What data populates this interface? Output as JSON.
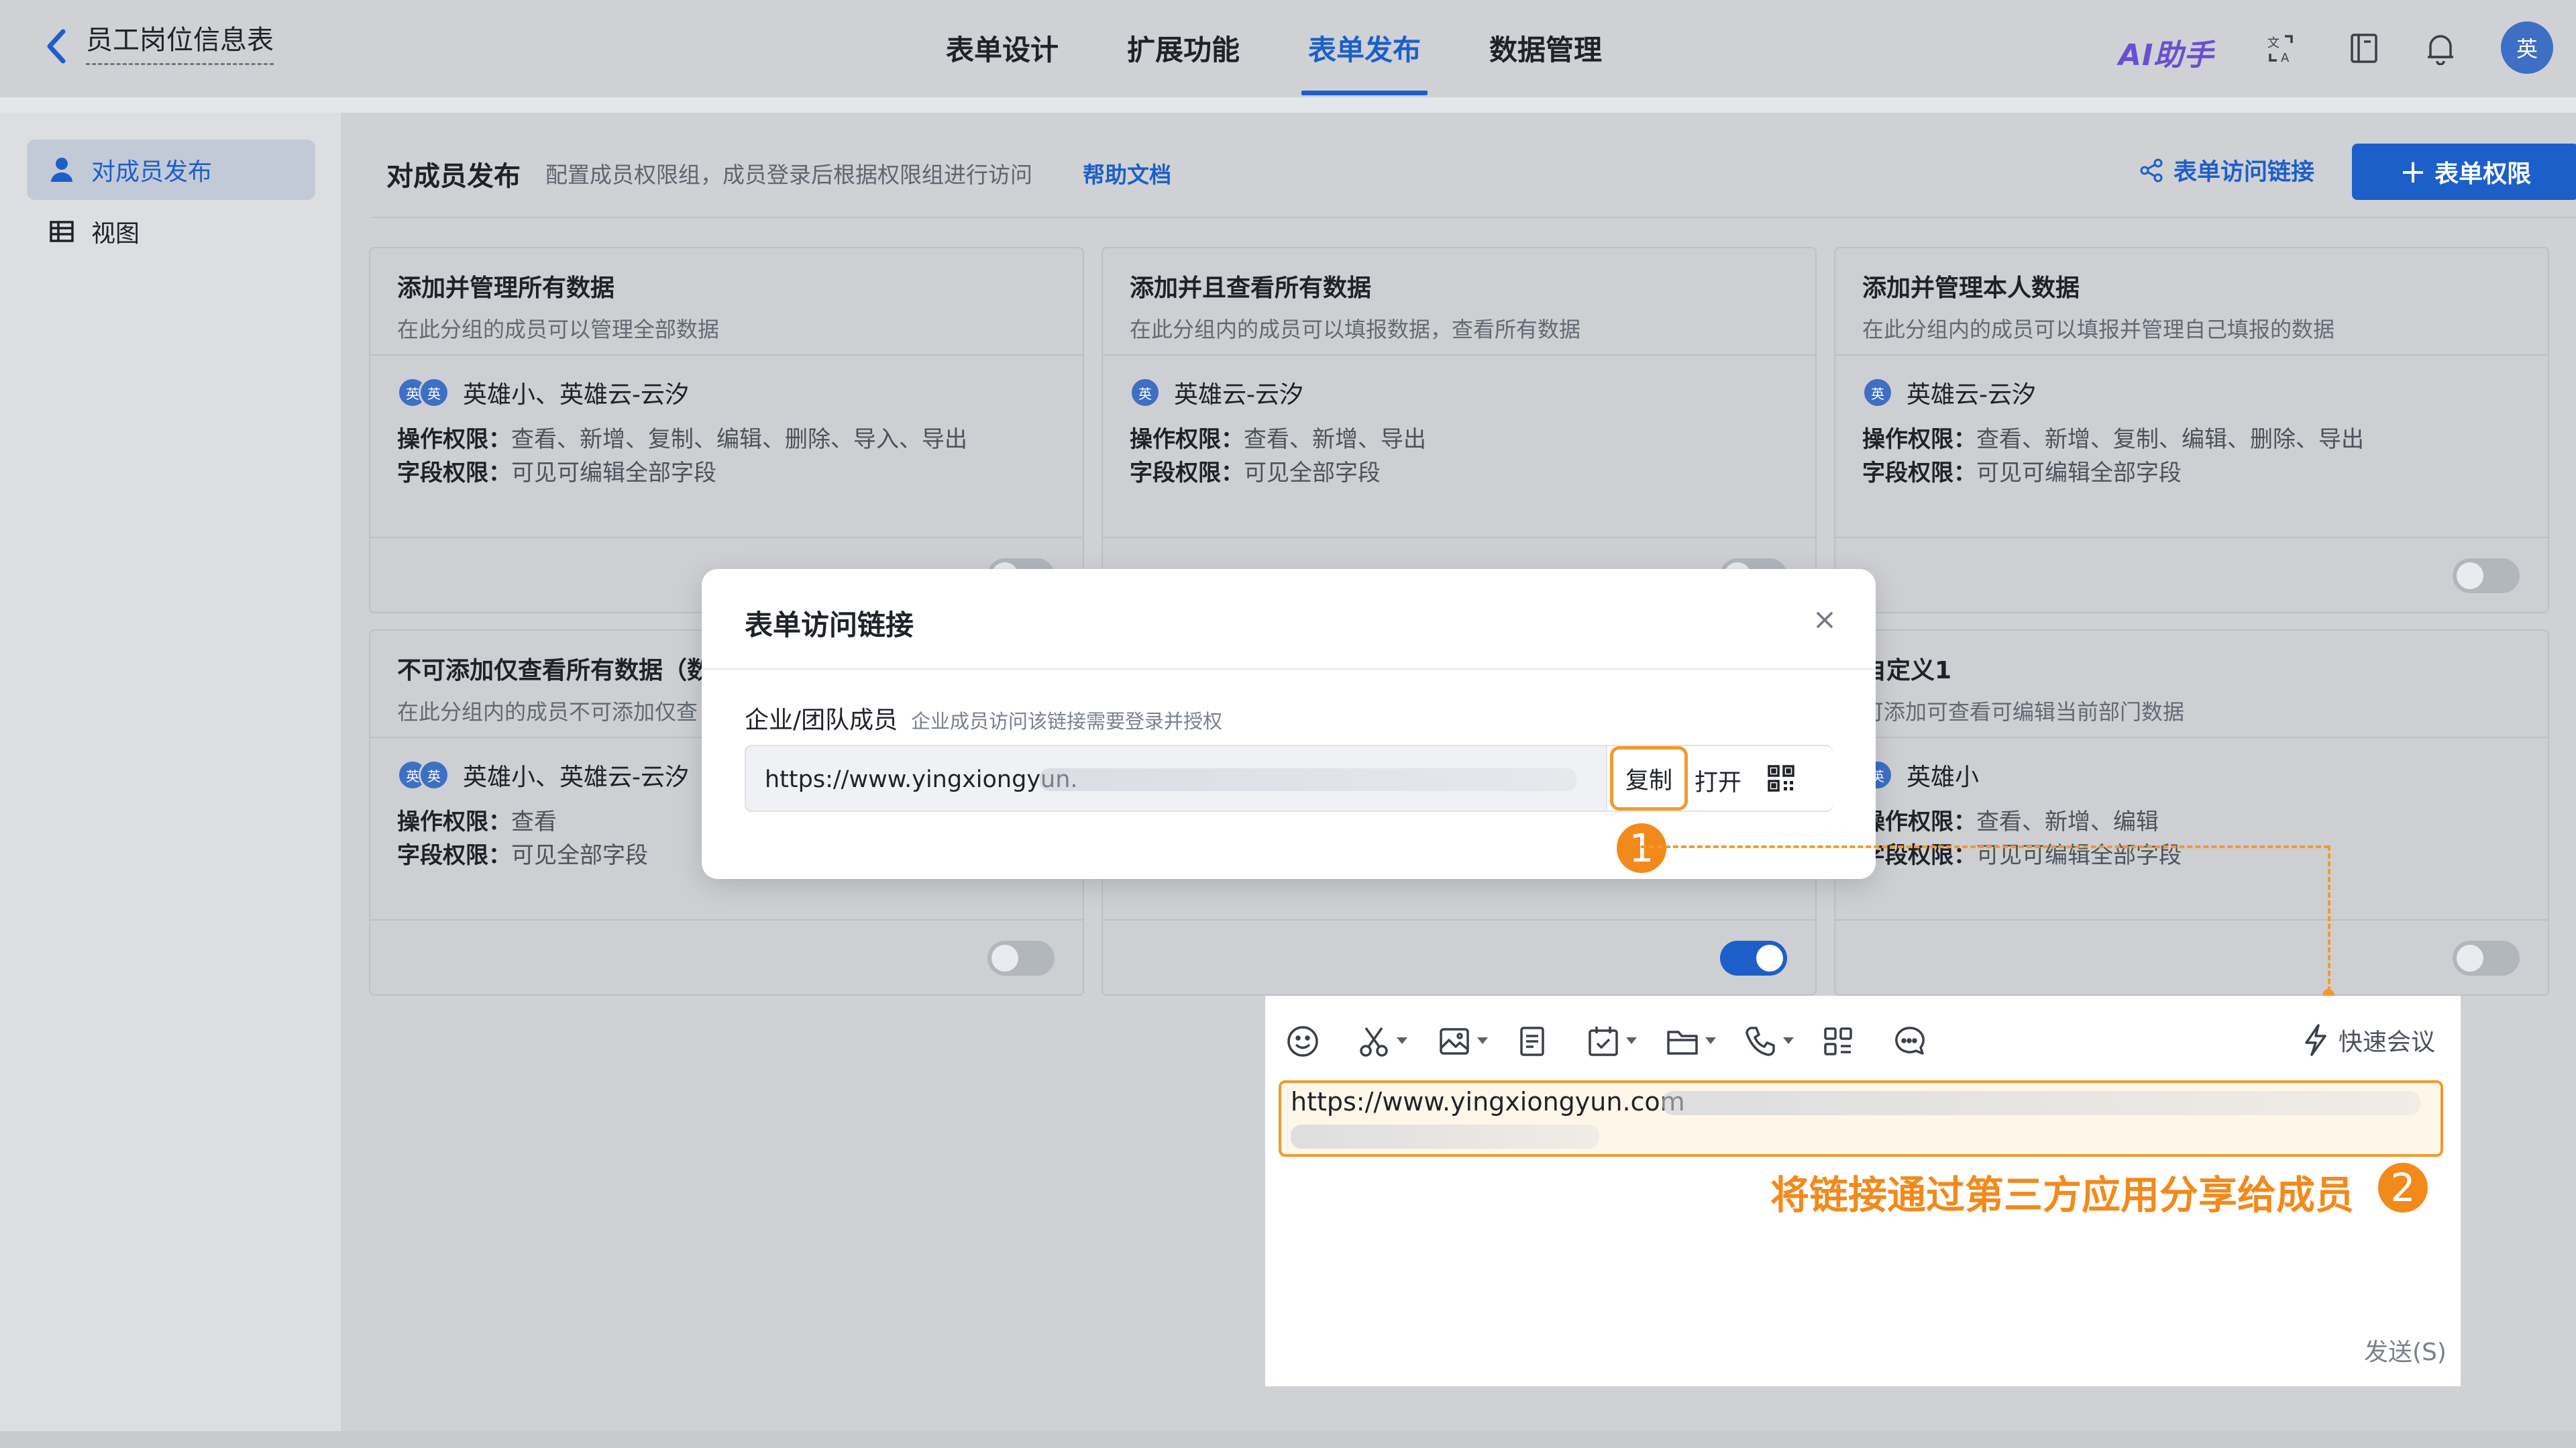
{
  "header": {
    "back_icon": "chevron-left-icon",
    "title": "员工岗位信息表",
    "tabs": [
      {
        "label": "表单设计",
        "active": false
      },
      {
        "label": "扩展功能",
        "active": false
      },
      {
        "label": "表单发布",
        "active": true
      },
      {
        "label": "数据管理",
        "active": false
      }
    ],
    "ai_label": "AI助手",
    "icons": [
      "translate-icon",
      "book-icon",
      "bell-icon"
    ],
    "user_initial": "英"
  },
  "sidebar": {
    "items": [
      {
        "label": "对成员发布",
        "icon": "user-icon",
        "active": true
      },
      {
        "label": "视图",
        "icon": "table-icon",
        "active": false
      }
    ]
  },
  "main": {
    "title": "对成员发布",
    "description": "配置成员权限组，成员登录后根据权限组进行访问",
    "help_link": "帮助文档",
    "access_link_button": "表单访问链接",
    "permission_button": "表单权限",
    "cards": [
      {
        "title": "添加并管理所有数据",
        "desc": "在此分组的成员可以管理全部数据",
        "members": "英雄小、英雄云-云汐",
        "ops_label": "操作权限：",
        "ops": "查看、新增、复制、编辑、删除、导入、导出",
        "fields_label": "字段权限：",
        "fields": "可见可编辑全部字段",
        "enabled": false
      },
      {
        "title": "添加并且查看所有数据",
        "desc": "在此分组内的成员可以填报数据，查看所有数据",
        "members": "英雄云-云汐",
        "ops_label": "操作权限：",
        "ops": "查看、新增、导出",
        "fields_label": "字段权限：",
        "fields": "可见全部字段",
        "enabled": false
      },
      {
        "title": "添加并管理本人数据",
        "desc": "在此分组内的成员可以填报并管理自己填报的数据",
        "members": "英雄云-云汐",
        "ops_label": "操作权限：",
        "ops": "查看、新增、复制、编辑、删除、导出",
        "fields_label": "字段权限：",
        "fields": "可见可编辑全部字段",
        "enabled": false
      },
      {
        "title": "不可添加仅查看所有数据（数",
        "desc": "在此分组内的成员不可添加仅查",
        "members": "英雄小、英雄云-云汐",
        "ops_label": "操作权限：",
        "ops": "查看",
        "fields_label": "字段权限：",
        "fields": "可见全部字段",
        "enabled": false
      },
      {
        "title": "",
        "desc": "",
        "members": "",
        "ops_label": "",
        "ops": "",
        "fields_label": "",
        "fields": "",
        "enabled": true
      },
      {
        "title": "自定义1",
        "desc": "可添加可查看可编辑当前部门数据",
        "members": "英雄小",
        "ops_label": "操作权限：",
        "ops": "查看、新增、编辑",
        "fields_label": "字段权限：",
        "fields": "可见可编辑全部字段",
        "enabled": false
      }
    ],
    "avatar_char": "英"
  },
  "modal": {
    "title": "表单访问链接",
    "label": "企业/团队成员",
    "hint": "企业成员访问该链接需要登录并授权",
    "url": "https://www.yingxiongyun.",
    "copy": "复制",
    "open": "打开",
    "qr_icon": "qrcode-icon",
    "close_icon": "close-icon",
    "badge": "1"
  },
  "chat": {
    "toolbar_icons": [
      "emoji-icon",
      "scissors-icon",
      "image-icon",
      "document-icon",
      "calendar-check-icon",
      "folder-icon",
      "phone-icon",
      "apps-icon",
      "chat-bubble-icon"
    ],
    "quick_meeting": "快速会议",
    "url": "https://www.yingxiongyun.com",
    "caption": "将链接通过第三方应用分享给成员",
    "badge": "2",
    "send": "发送(S)"
  },
  "colors": {
    "accent": "#1d5fc8",
    "highlight": "#f29a2e",
    "ai": "#6a4fd0"
  }
}
